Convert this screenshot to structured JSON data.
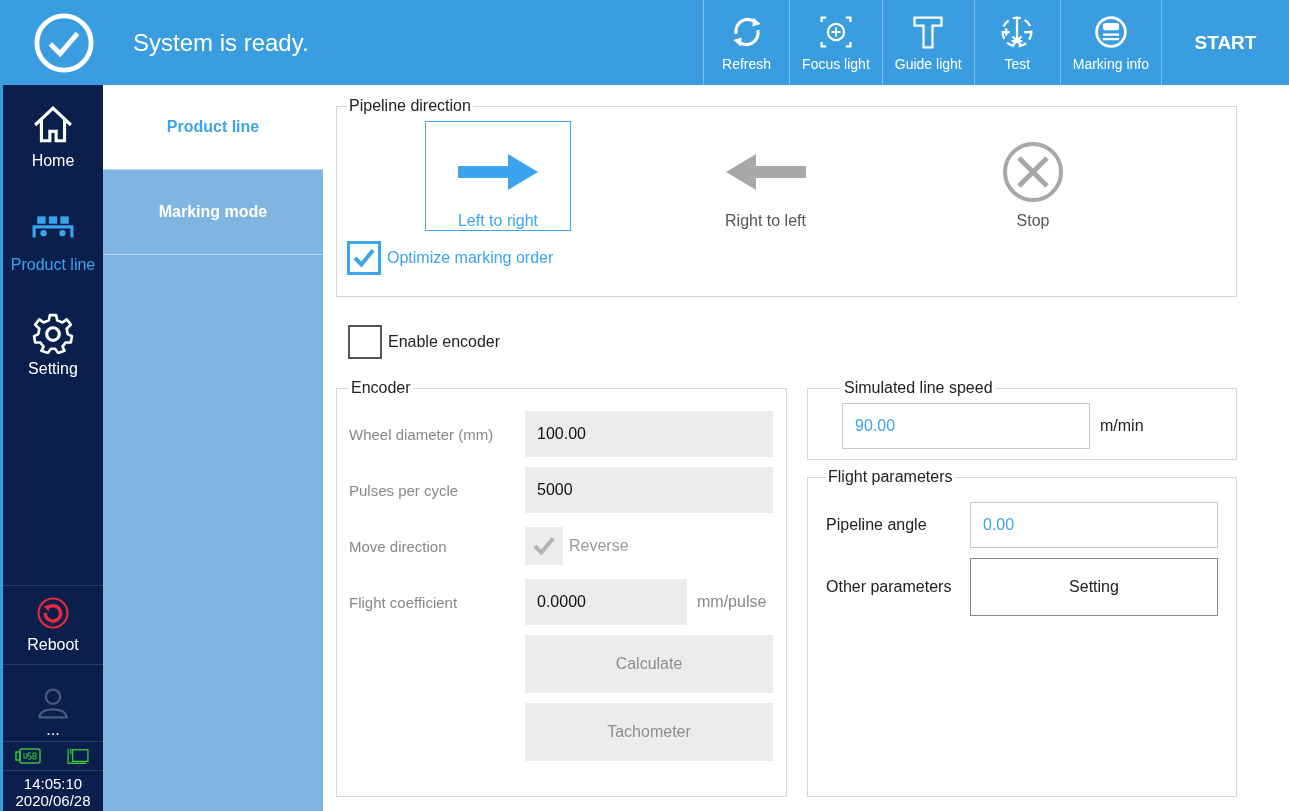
{
  "header": {
    "title": "System is ready.",
    "tools": [
      {
        "label": "Refresh",
        "kind": "refresh"
      },
      {
        "label": "Focus light",
        "kind": "focus"
      },
      {
        "label": "Guide light",
        "kind": "guide"
      },
      {
        "label": "Test",
        "kind": "test"
      },
      {
        "label": "Marking info",
        "kind": "info"
      }
    ],
    "start": "START"
  },
  "nav": {
    "items": [
      {
        "label": "Home",
        "kind": "home",
        "selected": false
      },
      {
        "label": "Product line",
        "kind": "line",
        "selected": true
      },
      {
        "label": "Setting",
        "kind": "gear",
        "selected": false
      }
    ],
    "reboot": "Reboot",
    "user": "...",
    "time": "14:05:10",
    "date": "2020/06/28"
  },
  "submenu": [
    {
      "label": "Product line",
      "selected": true
    },
    {
      "label": "Marking mode",
      "selected": false
    }
  ],
  "pipeline": {
    "title": "Pipeline direction",
    "directions": [
      {
        "label": "Left to right",
        "kind": "right",
        "selected": true
      },
      {
        "label": "Right to left",
        "kind": "left",
        "selected": false
      },
      {
        "label": "Stop",
        "kind": "stop",
        "selected": false
      }
    ],
    "optimize": {
      "label": "Optimize marking order",
      "checked": true
    }
  },
  "enable_encoder": {
    "label": "Enable encoder",
    "checked": false
  },
  "encoder": {
    "title": "Encoder",
    "disabled": true,
    "rows": [
      {
        "label": "Wheel diameter (mm)",
        "kind": "input",
        "value": "100.00"
      },
      {
        "label": "Pulses per cycle",
        "kind": "input",
        "value": "5000"
      },
      {
        "label": "Move direction",
        "kind": "checkbox",
        "option": "Reverse",
        "checked": true
      },
      {
        "label": "Flight coefficient",
        "kind": "input",
        "value": "0.0000",
        "unit": "mm/pulse"
      }
    ],
    "buttons": [
      "Calculate",
      "Tachometer"
    ]
  },
  "line_speed": {
    "title": "Simulated line speed",
    "value": "90.00",
    "unit": "m/min"
  },
  "flight": {
    "title": "Flight parameters",
    "rows": [
      {
        "label": "Pipeline angle",
        "kind": "input",
        "value": "0.00"
      },
      {
        "label": "Other parameters",
        "kind": "button",
        "text": "Setting"
      }
    ]
  }
}
